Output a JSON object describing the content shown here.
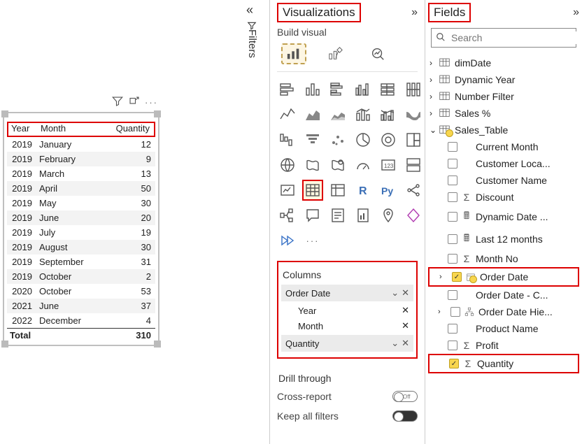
{
  "table_visual": {
    "headers": {
      "year": "Year",
      "month": "Month",
      "qty": "Quantity"
    },
    "rows": [
      {
        "year": "2019",
        "month": "January",
        "qty": "12"
      },
      {
        "year": "2019",
        "month": "February",
        "qty": "9"
      },
      {
        "year": "2019",
        "month": "March",
        "qty": "13"
      },
      {
        "year": "2019",
        "month": "April",
        "qty": "50"
      },
      {
        "year": "2019",
        "month": "May",
        "qty": "30"
      },
      {
        "year": "2019",
        "month": "June",
        "qty": "20"
      },
      {
        "year": "2019",
        "month": "July",
        "qty": "19"
      },
      {
        "year": "2019",
        "month": "August",
        "qty": "30"
      },
      {
        "year": "2019",
        "month": "September",
        "qty": "31"
      },
      {
        "year": "2019",
        "month": "October",
        "qty": "2"
      },
      {
        "year": "2020",
        "month": "October",
        "qty": "53"
      },
      {
        "year": "2021",
        "month": "June",
        "qty": "37"
      },
      {
        "year": "2022",
        "month": "December",
        "qty": "4"
      }
    ],
    "total_label": "Total",
    "total_value": "310"
  },
  "filters": {
    "label": "Filters"
  },
  "viz_pane": {
    "title": "Visualizations",
    "build_label": "Build visual",
    "columns_label": "Columns",
    "wells": {
      "order_date": "Order Date",
      "year": "Year",
      "month": "Month",
      "quantity": "Quantity"
    },
    "drill_through": "Drill through",
    "cross_report": "Cross-report",
    "cross_report_state": "Off",
    "keep_all": "Keep all filters"
  },
  "fields_pane": {
    "title": "Fields",
    "search_placeholder": "Search",
    "tables": {
      "dimDate": "dimDate",
      "dynamic_year": "Dynamic Year",
      "number_filter": "Number Filter",
      "sales_pct": "Sales %",
      "sales_table": "Sales_Table"
    },
    "fields": {
      "current_month": "Current Month",
      "customer_loca": "Customer Loca...",
      "customer_name": "Customer Name",
      "discount": "Discount",
      "dynamic_date": "Dynamic Date ...",
      "last_12": "Last 12 months",
      "month_no": "Month No",
      "order_date": "Order Date",
      "order_date_c": "Order Date - C...",
      "order_date_hie": "Order Date Hie...",
      "product_name": "Product Name",
      "profit": "Profit",
      "quantity": "Quantity"
    }
  }
}
